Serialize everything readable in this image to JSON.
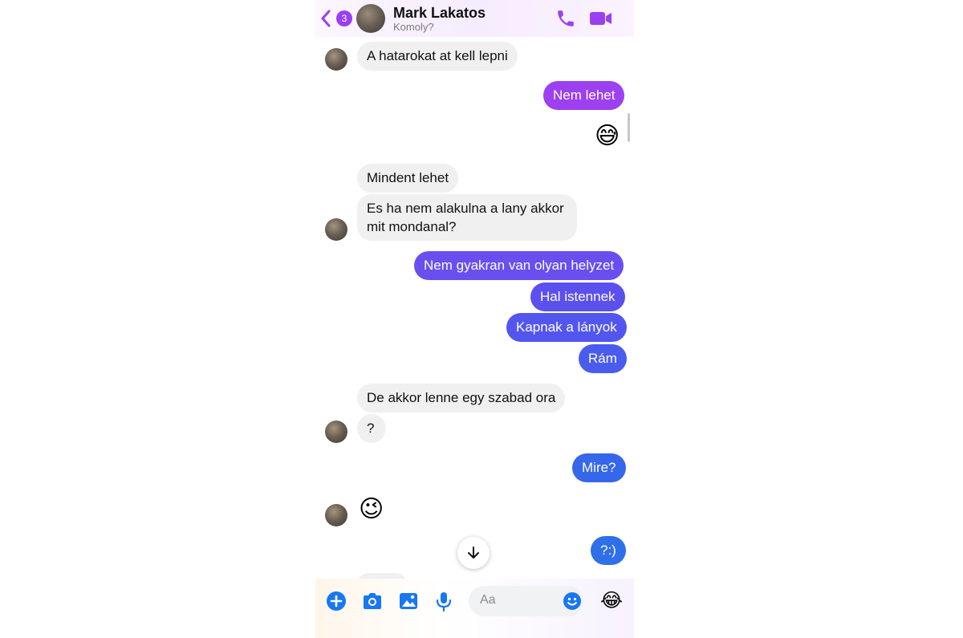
{
  "header": {
    "unread_count": "3",
    "contact_name": "Mark Lakatos",
    "status": "Komoly?",
    "icons": [
      "back-chevron-icon",
      "phone-icon",
      "video-camera-icon"
    ]
  },
  "colors": {
    "accent": "#9a3ff2",
    "incoming_bubble": "#f0f0f1",
    "outgoing_purple": "#9c40f0",
    "outgoing_indigo": "#5a50ee",
    "outgoing_blue": "#2f6fe9",
    "composer_icon": "#1877f2"
  },
  "messages": [
    {
      "from": "them",
      "text": "A hatarokat at kell lepni"
    },
    {
      "from": "me",
      "text": "Nem lehet"
    },
    {
      "from": "me",
      "emoji": "😅"
    },
    {
      "from": "them",
      "text": "Mindent lehet"
    },
    {
      "from": "them",
      "text": "Es ha nem alakulna a lany akkor"
    },
    {
      "from": "them",
      "text": "mit mondanal?"
    },
    {
      "from": "me",
      "text": "Nem gyakran van olyan helyzet"
    },
    {
      "from": "me",
      "text": "Hal istennek"
    },
    {
      "from": "me",
      "text": "Kapnak a lányok"
    },
    {
      "from": "me",
      "text": "Rám"
    },
    {
      "from": "them",
      "text": "De akkor lenne egy szabad ora"
    },
    {
      "from": "them",
      "text": "?"
    },
    {
      "from": "me",
      "text": "Mire?"
    },
    {
      "from": "them",
      "emoji": "😉"
    },
    {
      "from": "me",
      "text": "?:)"
    }
  ],
  "composer": {
    "placeholder": "Aa",
    "quick_reaction": "😂",
    "icons": [
      "plus-icon",
      "camera-icon",
      "image-icon",
      "microphone-icon",
      "emoji-icon"
    ]
  }
}
